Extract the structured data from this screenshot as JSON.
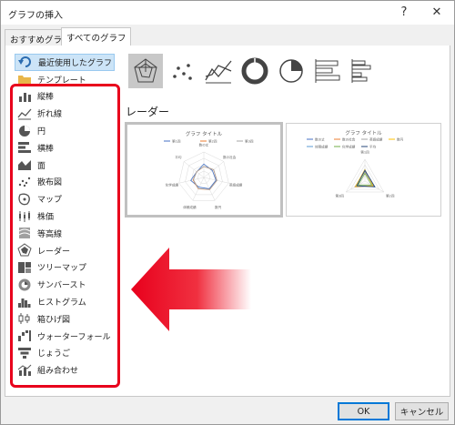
{
  "window": {
    "title": "グラフの挿入",
    "help_label": "?",
    "close_label": "✕"
  },
  "tabs": [
    {
      "label": "おすすめグラフ",
      "active": false
    },
    {
      "label": "すべてのグラフ",
      "active": true
    }
  ],
  "categories": [
    {
      "label": "最近使用したグラフ",
      "icon": "recent-undo-icon",
      "selected": true
    },
    {
      "label": "テンプレート",
      "icon": "folder-icon",
      "selected": false
    },
    {
      "label": "縦棒",
      "icon": "column-chart-icon",
      "selected": false
    },
    {
      "label": "折れ線",
      "icon": "line-chart-icon",
      "selected": false
    },
    {
      "label": "円",
      "icon": "pie-chart-icon",
      "selected": false
    },
    {
      "label": "横棒",
      "icon": "bar-chart-icon",
      "selected": false
    },
    {
      "label": "面",
      "icon": "area-chart-icon",
      "selected": false
    },
    {
      "label": "散布図",
      "icon": "scatter-chart-icon",
      "selected": false
    },
    {
      "label": "マップ",
      "icon": "map-chart-icon",
      "selected": false
    },
    {
      "label": "株価",
      "icon": "stock-chart-icon",
      "selected": false
    },
    {
      "label": "等高線",
      "icon": "surface-chart-icon",
      "selected": false
    },
    {
      "label": "レーダー",
      "icon": "radar-chart-icon",
      "selected": false
    },
    {
      "label": "ツリーマップ",
      "icon": "treemap-chart-icon",
      "selected": false
    },
    {
      "label": "サンバースト",
      "icon": "sunburst-chart-icon",
      "selected": false
    },
    {
      "label": "ヒストグラム",
      "icon": "histogram-chart-icon",
      "selected": false
    },
    {
      "label": "箱ひげ図",
      "icon": "box-whisker-chart-icon",
      "selected": false
    },
    {
      "label": "ウォーターフォール",
      "icon": "waterfall-chart-icon",
      "selected": false
    },
    {
      "label": "じょうご",
      "icon": "funnel-chart-icon",
      "selected": false
    },
    {
      "label": "組み合わせ",
      "icon": "combo-chart-icon",
      "selected": false
    }
  ],
  "subtypes": [
    {
      "icon": "radar-subtype-icon",
      "selected": true
    },
    {
      "icon": "scatter-subtype-icon",
      "selected": false
    },
    {
      "icon": "line-subtype-icon",
      "selected": false
    },
    {
      "icon": "doughnut-subtype-icon",
      "selected": false
    },
    {
      "icon": "pie-subtype-icon",
      "selected": false
    },
    {
      "icon": "stacked-bar-subtype-icon",
      "selected": false
    },
    {
      "icon": "clustered-bar-subtype-icon",
      "selected": false
    }
  ],
  "section_title": "レーダー",
  "preview1": {
    "title": "グラフ タイトル",
    "legend": [
      "第1四",
      "第2四",
      "第3四"
    ],
    "axes": [
      "数の丈",
      "数の社会",
      "英語成績",
      "数円",
      "体積成績",
      "化学成績",
      "平均"
    ]
  },
  "preview2": {
    "title": "グラフ タイトル",
    "legend": [
      "数の丈",
      "数の社会",
      "英語成績",
      "数円",
      "体積成績",
      "化学成績",
      "平均"
    ],
    "axes": [
      "第1四",
      "第2四",
      "第3四"
    ]
  },
  "colors": {
    "series": [
      "#4472c4",
      "#ed7d31",
      "#a5a5a5",
      "#ffc000",
      "#5b9bd5",
      "#70ad47",
      "#264478"
    ],
    "accent_red": "#e8001c",
    "selected_bg": "#cce4f7"
  },
  "buttons": {
    "ok": "OK",
    "cancel": "キャンセル"
  }
}
